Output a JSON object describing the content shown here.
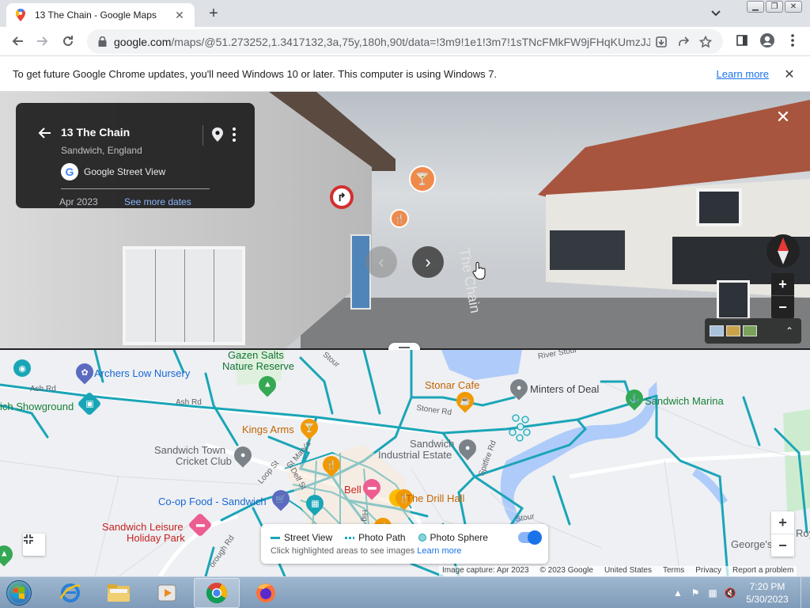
{
  "browser": {
    "tab_title": "13 The Chain - Google Maps",
    "url_domain": "google.com",
    "url_path": "/maps/@51.273252,1.3417132,3a,75y,180h,90t/data=!3m9!1e1!3m7!1sTNcFMkFW9jFHqKUmzJJ...",
    "window_controls": [
      "minimize",
      "restore",
      "close"
    ]
  },
  "infobar": {
    "message": "To get future Google Chrome updates, you'll need Windows 10 or later. This computer is using Windows 7.",
    "learn_more": "Learn more"
  },
  "streetview": {
    "place_name": "13 The Chain",
    "place_sub": "Sandwich, England",
    "source": "Google Street View",
    "date": "Apr 2023",
    "see_more_dates": "See more dates",
    "road_label": "The Chain",
    "road_sign": "↱"
  },
  "map": {
    "labels": {
      "gazen_salts": "Gazen Salts",
      "nature_reserve": "Nature Reserve",
      "archers": "Archers Low Nursery",
      "ash_rd_1": "Ash Rd",
      "ash_rd_2": "Ash Rd",
      "showground": "ich Showground",
      "kings_arms": "Kings Arms",
      "stonar_cafe": "Stonar Cafe",
      "minters": "Minters of Deal",
      "marina": "Sandwich Marina",
      "river_stour": "River Stour",
      "stonar_rd": "Stoner Rd",
      "industrial_1": "Sandwich",
      "industrial_2": "Industrial Estate",
      "spitfire": "Spitfire Rd",
      "town_cricket_1": "Sandwich Town",
      "town_cricket_2": "Cricket Club",
      "coop": "Co-op Food - Sandwich",
      "bell": "Bell",
      "drill_hall": "The Drill Hall",
      "leisure_1": "Sandwich Leisure",
      "leisure_2": "Holiday Park",
      "royal_1": "The Royal",
      "royal_2": "George's Cl",
      "stour_top": "Stour",
      "loop_st": "Loop St",
      "delf_st": "Delf St",
      "st_marys": "St Mary's",
      "high": "Hig",
      "borough_rd": "orough Rd",
      "stour_small": "Stour"
    },
    "legend": {
      "street_view": "Street View",
      "photo_path": "Photo Path",
      "photo_sphere": "Photo Sphere",
      "hint": "Click highlighted areas to see images",
      "learn_more": "Learn more",
      "layer_on": true
    },
    "attribution": {
      "capture": "Image capture: Apr 2023",
      "copyright": "© 2023 Google",
      "country": "United States",
      "terms": "Terms",
      "privacy": "Privacy",
      "report": "Report a problem"
    }
  },
  "taskbar": {
    "time": "7:20 PM",
    "date": "5/30/2023",
    "apps": [
      "internet-explorer",
      "file-explorer",
      "media-player",
      "chrome",
      "firefox"
    ]
  },
  "colors": {
    "coverage": "#1aa5b7",
    "water": "#aecbfa",
    "park": "#cdeccf",
    "accent": "#1a73e8"
  }
}
